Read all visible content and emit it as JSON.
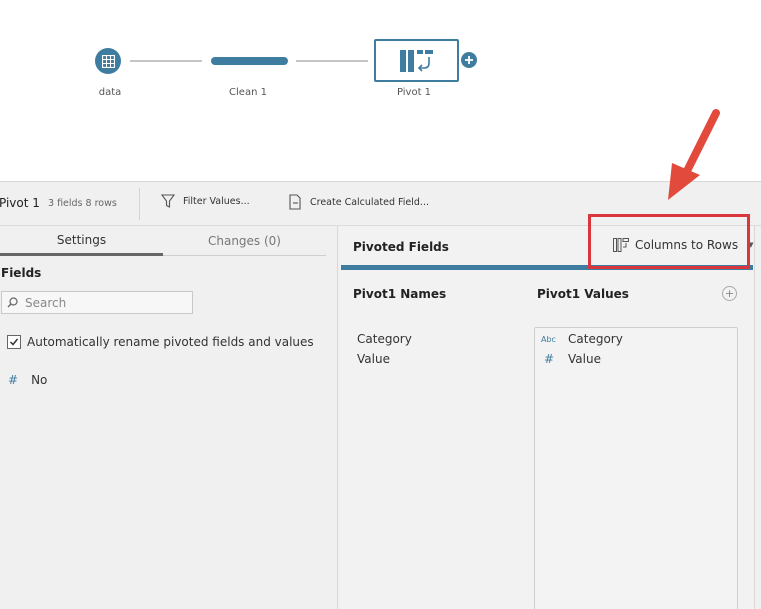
{
  "flow": {
    "nodes": [
      {
        "label": "data",
        "icon": "table-icon"
      },
      {
        "label": "Clean 1",
        "icon": "clean-step-icon"
      },
      {
        "label": "Pivot 1",
        "icon": "pivot-icon"
      }
    ],
    "add_icon": "plus-icon"
  },
  "toolbar": {
    "step_name": "Pivot 1",
    "meta": "3 fields  8 rows",
    "filter_label": "Filter Values...",
    "calc_label": "Create Calculated Field..."
  },
  "left": {
    "tabs": [
      {
        "label": "Settings",
        "active": true
      },
      {
        "label": "Changes (0)",
        "active": false
      }
    ],
    "fields_heading": "Fields",
    "search_placeholder": "Search",
    "auto_rename_label": "Automatically rename pivoted fields and values",
    "auto_rename_checked": true,
    "fields": [
      {
        "type_icon": "#",
        "name": "No"
      }
    ]
  },
  "right": {
    "title": "Pivoted Fields",
    "mode_label": "Columns to Rows",
    "names_heading": "Pivot1 Names",
    "values_heading": "Pivot1 Values",
    "names": [
      "Category",
      "Value"
    ],
    "values": [
      {
        "type_icon": "Abc",
        "name": "Category"
      },
      {
        "type_icon": "#",
        "name": "Value"
      }
    ]
  },
  "colors": {
    "accent": "#3e7ca0",
    "annotation": "#d9363e"
  }
}
